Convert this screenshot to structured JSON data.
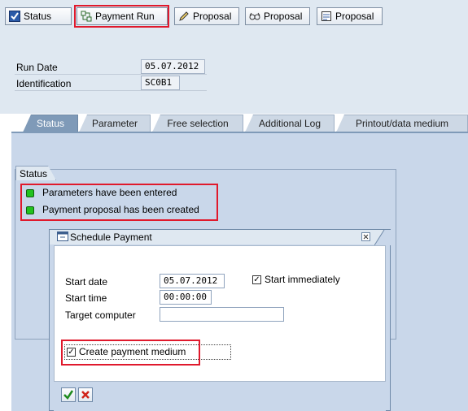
{
  "toolbar": {
    "status_label": "Status",
    "payment_run_label": "Payment Run",
    "edit_proposal_label": "Proposal",
    "display_proposal_label": "Proposal",
    "log_proposal_label": "Proposal"
  },
  "header": {
    "run_date_label": "Run Date",
    "run_date_value": "05.07.2012",
    "identification_label": "Identification",
    "identification_value": "SC0B1"
  },
  "tabs": [
    "Status",
    "Parameter",
    "Free selection",
    "Additional Log",
    "Printout/data medium"
  ],
  "active_tab": "Status",
  "status": {
    "title": "Status",
    "lines": [
      "Parameters have been entered",
      "Payment proposal has been created"
    ]
  },
  "dialog": {
    "title": "Schedule Payment",
    "start_date_label": "Start date",
    "start_date_value": "05.07.2012",
    "start_immediately_label": "Start immediately",
    "start_immediately_checked": true,
    "start_time_label": "Start time",
    "start_time_value": "00:00:00",
    "target_computer_label": "Target computer",
    "target_computer_value": "",
    "create_payment_medium_label": "Create payment medium",
    "create_payment_medium_checked": true
  },
  "colors": {
    "highlight": "#e0192c",
    "led_green": "#22c21e",
    "panel_bg": "#c9d7ea",
    "tab_active": "#7f9ab8"
  }
}
